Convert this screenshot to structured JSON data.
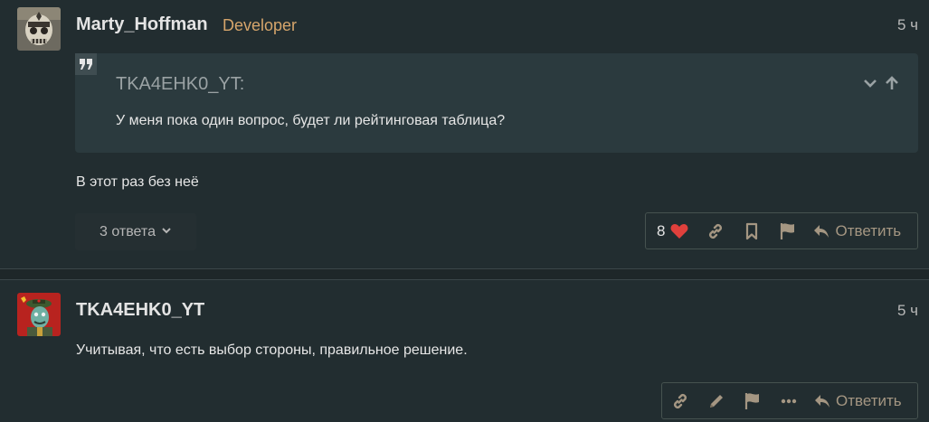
{
  "posts": [
    {
      "username": "Marty_Hoffman",
      "role": "Developer",
      "time": "5 ч",
      "quote": {
        "author": "TKA4EHK0_YT:",
        "text": "У меня пока один вопрос, будет ли рейтинговая таблица?"
      },
      "body": "В этот раз без неё",
      "replies_label": "3 ответа",
      "likes": "8",
      "reply_label": "Ответить"
    },
    {
      "username": "TKA4EHK0_YT",
      "time": "5 ч",
      "body": "Учитывая, что есть выбор стороны, правильное решение.",
      "reply_label": "Ответить"
    }
  ],
  "icons": {
    "quote": "quote-icon",
    "expand": "chevron-down-icon",
    "jump": "arrow-up-icon",
    "heart": "heart-icon",
    "link": "link-icon",
    "bookmark": "bookmark-icon",
    "flag": "flag-icon",
    "edit": "pencil-icon",
    "more": "ellipsis-icon",
    "reply": "reply-icon"
  },
  "colors": {
    "background": "#222d30",
    "quote_background": "#2b3a3e",
    "role": "#d6a56b",
    "action": "#a49682",
    "heart": "#e0403c"
  }
}
